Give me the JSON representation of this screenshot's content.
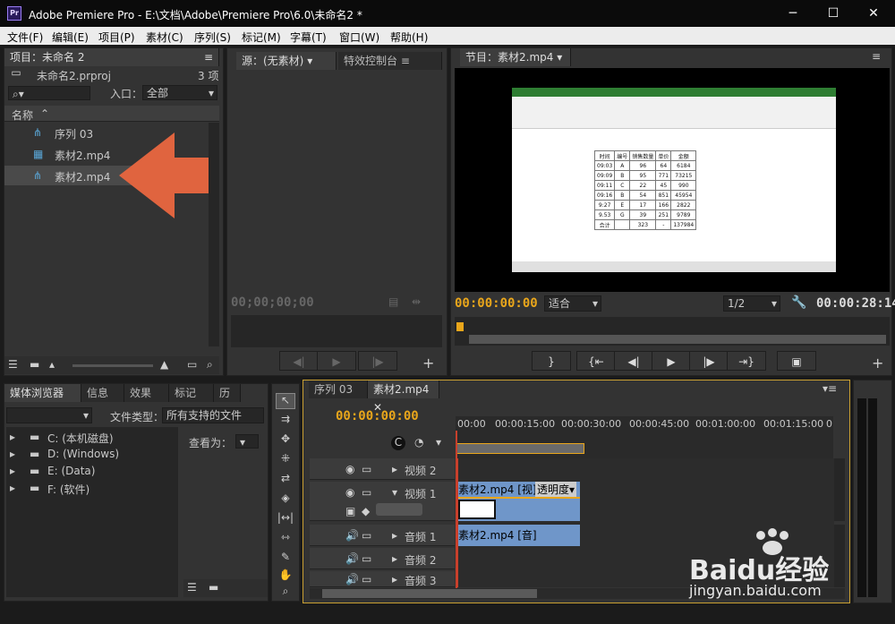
{
  "window": {
    "title": "Adobe Premiere Pro - E:\\文档\\Adobe\\Premiere Pro\\6.0\\未命名2 *",
    "logo": "Pr",
    "minimize": "─",
    "maximize": "☐",
    "close": "✕"
  },
  "menu": [
    "文件(F)",
    "编辑(E)",
    "项目(P)",
    "素材(C)",
    "序列(S)",
    "标记(M)",
    "字幕(T)",
    "窗口(W)",
    "帮助(H)"
  ],
  "project": {
    "tab": "项目：未命名 2",
    "menu_icon": "≡",
    "filename": "未命名2.prproj",
    "count": "3 项",
    "entry_label": "入口：",
    "entry_value": "全部",
    "column_name": "名称",
    "items": [
      {
        "name": "序列 03"
      },
      {
        "name": "素材2.mp4"
      },
      {
        "name": "素材2.mp4"
      }
    ]
  },
  "source": {
    "tab1": "源：(无素材)",
    "tab2": "特效控制台",
    "timecode": "00;00;00;00"
  },
  "program": {
    "tab": "节目：素材2.mp4",
    "timecode_left": "00:00:00:00",
    "fit": "适合",
    "ratio": "1/2",
    "timecode_right": "00:00:28:14"
  },
  "excel": {
    "headers": [
      "时间",
      "编号",
      "销售数量",
      "单价",
      "金额"
    ],
    "rows": [
      [
        "09:03",
        "A",
        "96",
        "64",
        "6184"
      ],
      [
        "09:09",
        "B",
        "95",
        "771",
        "73215"
      ],
      [
        "09:11",
        "C",
        "22",
        "45",
        "990"
      ],
      [
        "09:16",
        "B",
        "54",
        "851",
        "45954"
      ],
      [
        "9:27",
        "E",
        "17",
        "166",
        "2822"
      ],
      [
        "9.53",
        "G",
        "39",
        "251",
        "9789"
      ],
      [
        "合计",
        "",
        "323",
        "-",
        "137984"
      ]
    ]
  },
  "browser": {
    "tabs": [
      "媒体浏览器",
      "信息",
      "效果",
      "标记",
      "历"
    ],
    "filetype_label": "文件类型：",
    "filetype_value": "所有支持的文件",
    "view_label": "查看为：",
    "drives": [
      "C: (本机磁盘)",
      "D: (Windows)",
      "E: (Data)",
      "F: (软件)"
    ]
  },
  "timeline": {
    "tab_seq": "序列 03",
    "tab_clip": "素材2.mp4",
    "timecode": "00:00:00:00",
    "ruler": [
      "00:00",
      "00:00:15:00",
      "00:00:30:00",
      "00:00:45:00",
      "00:01:00:00",
      "00:01:15:00",
      "0"
    ],
    "tracks": {
      "v2": "视频 2",
      "v1": "视频 1",
      "a1": "音频 1",
      "a2": "音频 2",
      "a3": "音频 3"
    },
    "clip_video": "素材2.mp4 [视]",
    "clip_opacity": "透明度",
    "clip_audio": "素材2.mp4 [音]"
  },
  "watermark": {
    "brand": "Baidu经验",
    "url": "jingyan.baidu.com"
  },
  "colors": {
    "accent": "#e9a61b",
    "arrow": "#e0643f",
    "clip": "#6f96c9"
  }
}
